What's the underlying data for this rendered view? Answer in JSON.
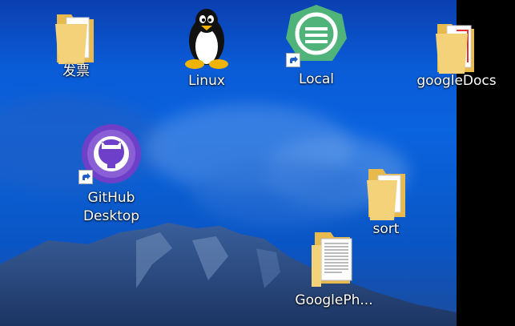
{
  "desktop": {
    "icons": [
      {
        "label": "发票",
        "icon": "folder-icon"
      },
      {
        "label": "Linux",
        "icon": "tux-penguin-icon"
      },
      {
        "label": "Local",
        "icon": "local-app-icon",
        "shortcut": true
      },
      {
        "label": "googleDocs",
        "icon": "folder-icon"
      },
      {
        "label": "GitHub Desktop",
        "line1": "GitHub",
        "line2": "Desktop",
        "icon": "github-desktop-icon",
        "shortcut": true
      },
      {
        "label": "sort",
        "icon": "folder-pdf-icon"
      },
      {
        "label": "GooglePh...",
        "icon": "folder-document-icon"
      }
    ]
  },
  "colors": {
    "wallpaper_blue": "#0a5bd6",
    "local_green": "#4fb37a",
    "github_purple": "#6e40c9",
    "folder_yellow": "#f4d27a"
  }
}
